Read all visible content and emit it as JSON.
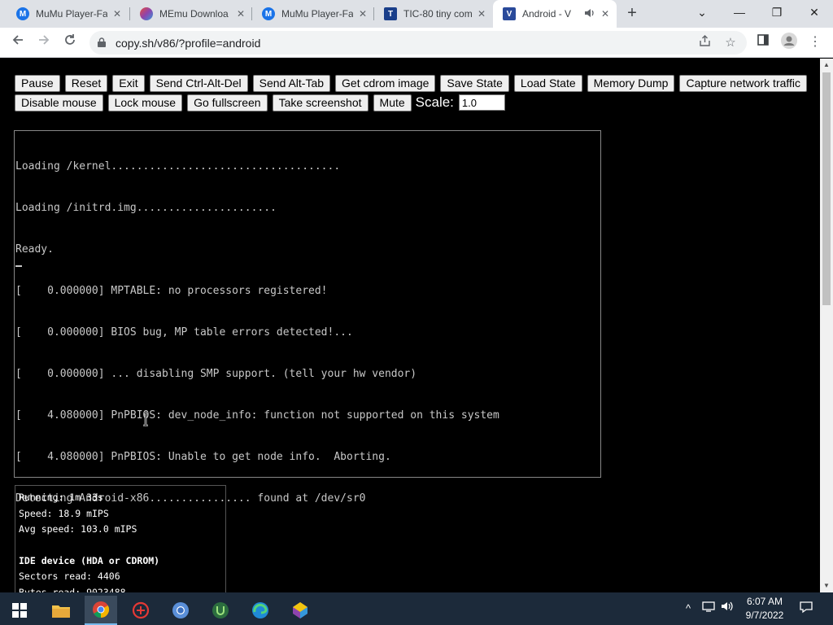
{
  "tabs": [
    {
      "title": "MuMu Player-Fa",
      "icon": "mumu-icon",
      "color": "#1a73e8"
    },
    {
      "title": "MEmu Downloa",
      "icon": "memu-icon",
      "color": "#8e44ad"
    },
    {
      "title": "MuMu Player-Fa",
      "icon": "mumu-icon",
      "color": "#1a73e8"
    },
    {
      "title": "TIC-80 tiny com",
      "icon": "tic80-icon",
      "color": "#1a3f8a"
    },
    {
      "title": "Android - V",
      "icon": "v86-icon",
      "color": "#2a4a9a",
      "active": true,
      "audio": true
    }
  ],
  "window": {
    "new_tab": "+",
    "search_tabs": "⌄",
    "minimize": "—",
    "restore": "❐",
    "close": "✕"
  },
  "address": {
    "url": "copy.sh/v86/?profile=android"
  },
  "controls": {
    "row1": [
      "Pause",
      "Reset",
      "Exit",
      "Send Ctrl-Alt-Del",
      "Send Alt-Tab",
      "Get cdrom image",
      "Save State",
      "Load State",
      "Memory Dump",
      "Capture network traffic"
    ],
    "row2": [
      "Disable mouse",
      "Lock mouse",
      "Go fullscreen",
      "Take screenshot",
      "Mute"
    ],
    "scale_label": "Scale:",
    "scale_value": "1.0"
  },
  "console_lines": [
    "Loading /kernel....................................",
    "Loading /initrd.img......................",
    "Ready.",
    "[    0.000000] MPTABLE: no processors registered!",
    "[    0.000000] BIOS bug, MP table errors detected!...",
    "[    0.000000] ... disabling SMP support. (tell your hw vendor)",
    "[    4.080000] PnPBIOS: dev_node_info: function not supported on this system",
    "[    4.080000] PnPBIOS: Unable to get node info.  Aborting.",
    "Detecting Android-x86................ found at /dev/sr0"
  ],
  "stats": {
    "running": "Running: 1m 33s",
    "speed": "Speed: 18.9 mIPS",
    "avg_speed": "Avg speed: 103.0 mIPS",
    "ide_header": "IDE device (HDA or CDROM)",
    "sectors_read": "Sectors read: 4406",
    "bytes_read": "Bytes read: 9023488"
  },
  "taskbar": {
    "apps": [
      "windows-start-icon",
      "file-explorer-icon",
      "chrome-icon",
      "game-icon",
      "chrome-alt-icon",
      "upwork-icon",
      "edge-icon",
      "memu-taskbar-icon"
    ],
    "time": "6:07 AM",
    "date": "9/7/2022"
  }
}
